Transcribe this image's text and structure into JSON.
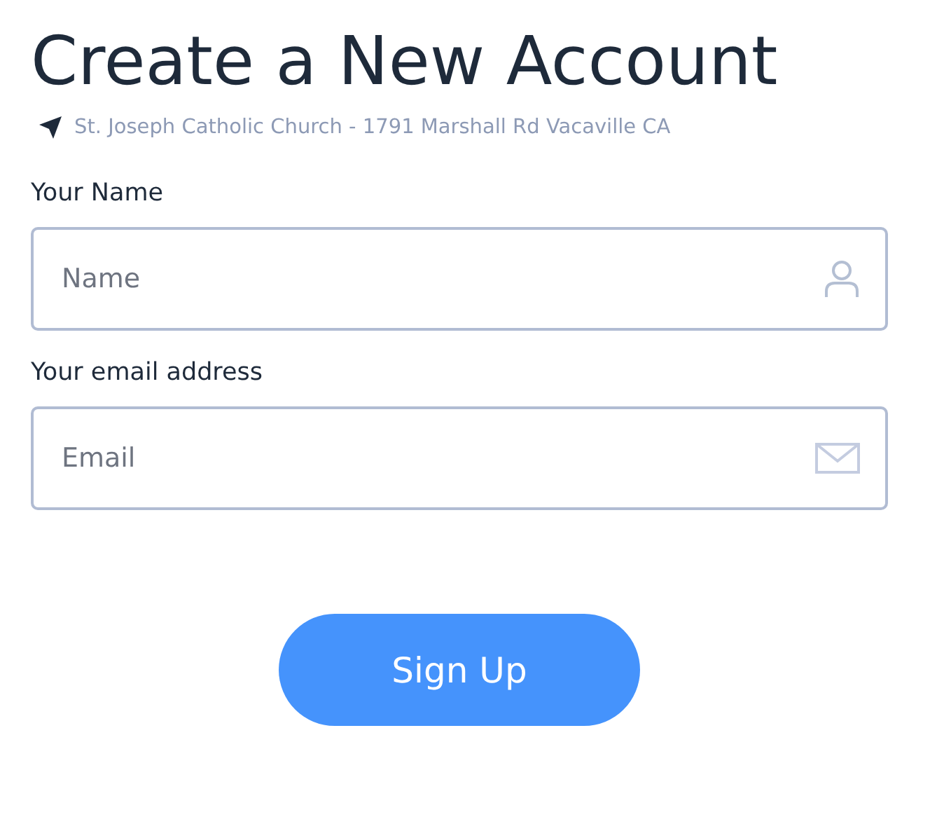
{
  "title": "Create a New Account",
  "location": "St. Joseph Catholic Church - 1791 Marshall Rd Vacaville CA",
  "fields": [
    {
      "label": "Your Name",
      "placeholder": "Name",
      "kind": "person"
    },
    {
      "label": "Your email address",
      "placeholder": "Email",
      "kind": "mail"
    }
  ],
  "button": "Sign Up"
}
